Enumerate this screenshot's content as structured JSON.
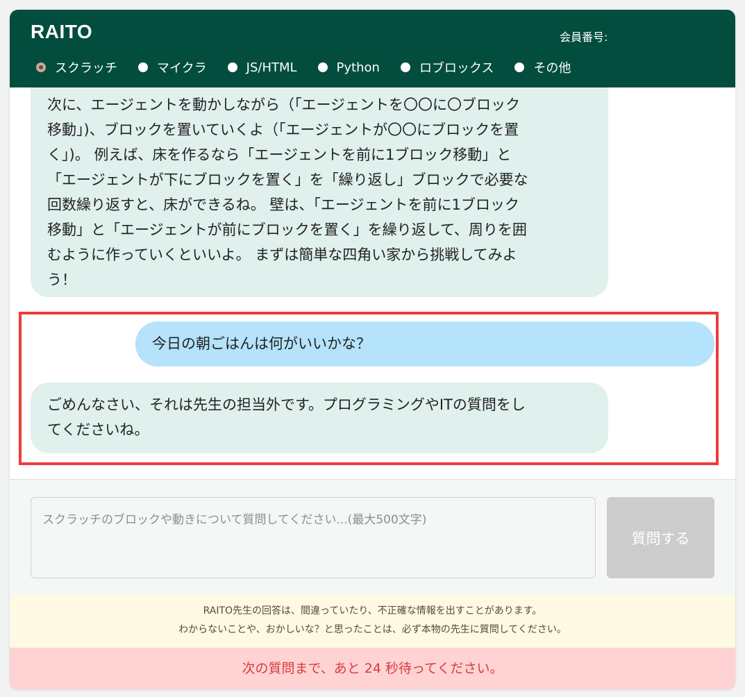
{
  "header": {
    "brand": "RAITO",
    "member_label": "会員番号:"
  },
  "languages": {
    "options": [
      {
        "label": "スクラッチ",
        "selected": true
      },
      {
        "label": "マイクラ",
        "selected": false
      },
      {
        "label": "JS/HTML",
        "selected": false
      },
      {
        "label": "Python",
        "selected": false
      },
      {
        "label": "ロブロックス",
        "selected": false
      },
      {
        "label": "その他",
        "selected": false
      }
    ]
  },
  "chat": {
    "messages": [
      {
        "role": "bot",
        "lines": [
          "次に、エージェントを動かしながら（「エージェントを〇〇に〇ブロック",
          "移動」)、ブロックを置いていくよ（「エージェントが〇〇にブロックを置",
          "く」)。 例えば、床を作るなら「エージェントを前に1ブロック移動」と",
          "「エージェントが下にブロックを置く」を「繰り返し」ブロックで必要な",
          "回数繰り返すと、床ができるね。 壁は、「エージェントを前に1ブロック",
          "移動」と「エージェントが前にブロックを置く」を繰り返して、周りを囲",
          "むように作っていくといいよ。 まずは簡単な四角い家から挑戦してみよ",
          "う！"
        ]
      },
      {
        "role": "user",
        "lines": [
          "今日の朝ごはんは何がいいかな？"
        ]
      },
      {
        "role": "bot",
        "lines": [
          "ごめんなさい、それは先生の担当外です。プログラミングやITの質問をし",
          "てくださいね。"
        ]
      }
    ]
  },
  "input": {
    "placeholder": "スクラッチのブロックや動きについて質問してください...(最大500文字)",
    "value": ""
  },
  "submit": {
    "label": "質問する"
  },
  "notice": {
    "line1": "RAITO先生の回答は、間違っていたり、不正確な情報を出すことがあります。",
    "line2": "わからないことや、おかしいな？と思ったことは、必ず本物の先生に質問してください。"
  },
  "wait_message": "次の質問まで、あと 24 秒待ってください。",
  "colors": {
    "header_bg": "#024d3d",
    "bot_bubble": "#dff0ed",
    "user_bubble": "#b4e3fb",
    "highlight_border": "#f03a3a",
    "submit_disabled": "#cccccc",
    "notice_bg": "#fdf9e2",
    "wait_bg": "#ffd3d3",
    "wait_text": "#d83a3a"
  }
}
